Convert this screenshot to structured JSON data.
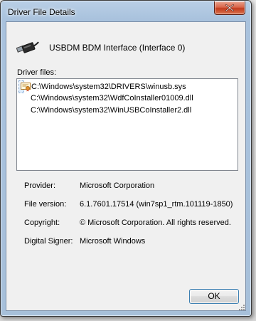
{
  "window": {
    "title": "Driver File Details"
  },
  "device": {
    "name": "USBDM BDM Interface (Interface 0)",
    "icon": "usb-plug-icon"
  },
  "driver_files": {
    "label": "Driver files:",
    "items": [
      {
        "path": "C:\\Windows\\system32\\DRIVERS\\winusb.sys",
        "signed_icon": "certificate-icon",
        "selected": true
      },
      {
        "path": "C:\\Windows\\system32\\WdfCoInstaller01009.dll",
        "selected": false
      },
      {
        "path": "C:\\Windows\\system32\\WinUSBCoInstaller2.dll",
        "selected": false
      }
    ]
  },
  "properties": {
    "provider_label": "Provider:",
    "provider_value": "Microsoft Corporation",
    "version_label": "File version:",
    "version_value": "6.1.7601.17514 (win7sp1_rtm.101119-1850)",
    "copyright_label": "Copyright:",
    "copyright_value": "© Microsoft Corporation. All rights reserved.",
    "signer_label": "Digital Signer:",
    "signer_value": "Microsoft Windows"
  },
  "buttons": {
    "ok_label": "OK"
  },
  "colors": {
    "close_button": "#c94a2b",
    "selection": "#dcebfc",
    "frame": "#a9c2dd"
  }
}
